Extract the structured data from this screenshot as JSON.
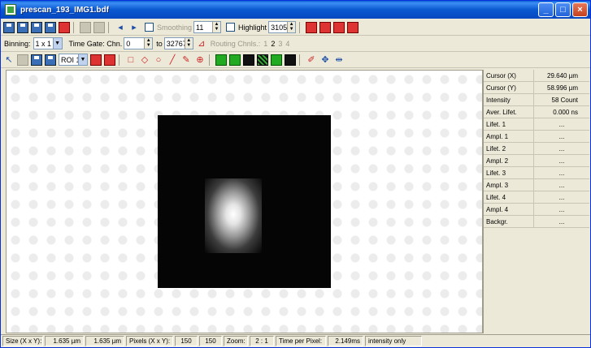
{
  "window": {
    "title": "prescan_193_IMG1.bdf",
    "controls": [
      "minimize",
      "maximize",
      "close"
    ]
  },
  "toolbar1": {
    "smoothing_label": "Smoothing",
    "smoothing_value": "11",
    "highlight_label": "Highlight",
    "highlight_value": "3105"
  },
  "toolbar2": {
    "binning_label": "Binning:",
    "binning_value": "1 x 1",
    "time_gate_label": "Time Gate: Chn.",
    "time_gate_from": "0",
    "to_label": "to",
    "time_gate_to": "32767",
    "routing_label": "Routing Chnls.:",
    "routing_channels": [
      "1",
      "2",
      "3",
      "4"
    ]
  },
  "toolbar3": {
    "roi_value": "ROI 1"
  },
  "panel": {
    "rows": [
      {
        "label": "Cursor (X)",
        "value": "29.640 µm"
      },
      {
        "label": "Cursor (Y)",
        "value": "58.996 µm"
      },
      {
        "label": "Intensity",
        "value": "58 Count"
      },
      {
        "label": "Aver. Lifet.",
        "value": "0.000 ns"
      },
      {
        "label": "Lifet. 1",
        "value": "..."
      },
      {
        "label": "Ampl. 1",
        "value": "..."
      },
      {
        "label": "Lifet. 2",
        "value": "..."
      },
      {
        "label": "Ampl. 2",
        "value": "..."
      },
      {
        "label": "Lifet. 3",
        "value": "..."
      },
      {
        "label": "Ampl. 3",
        "value": "..."
      },
      {
        "label": "Lifet. 4",
        "value": "..."
      },
      {
        "label": "Ampl. 4",
        "value": "..."
      },
      {
        "label": "Backgr.",
        "value": "..."
      }
    ]
  },
  "status": {
    "size_label": "Size (X x Y):",
    "size_x": "1.635 µm",
    "size_y": "1.635 µm",
    "pixels_label": "Pixels (X x Y):",
    "pixels_x": "150",
    "pixels_y": "150",
    "zoom_label": "Zoom:",
    "zoom_value": "2 : 1",
    "time_per_pixel_label": "Time per Pixel:",
    "time_per_pixel_value": "2.149ms",
    "mode": "intensity only"
  }
}
